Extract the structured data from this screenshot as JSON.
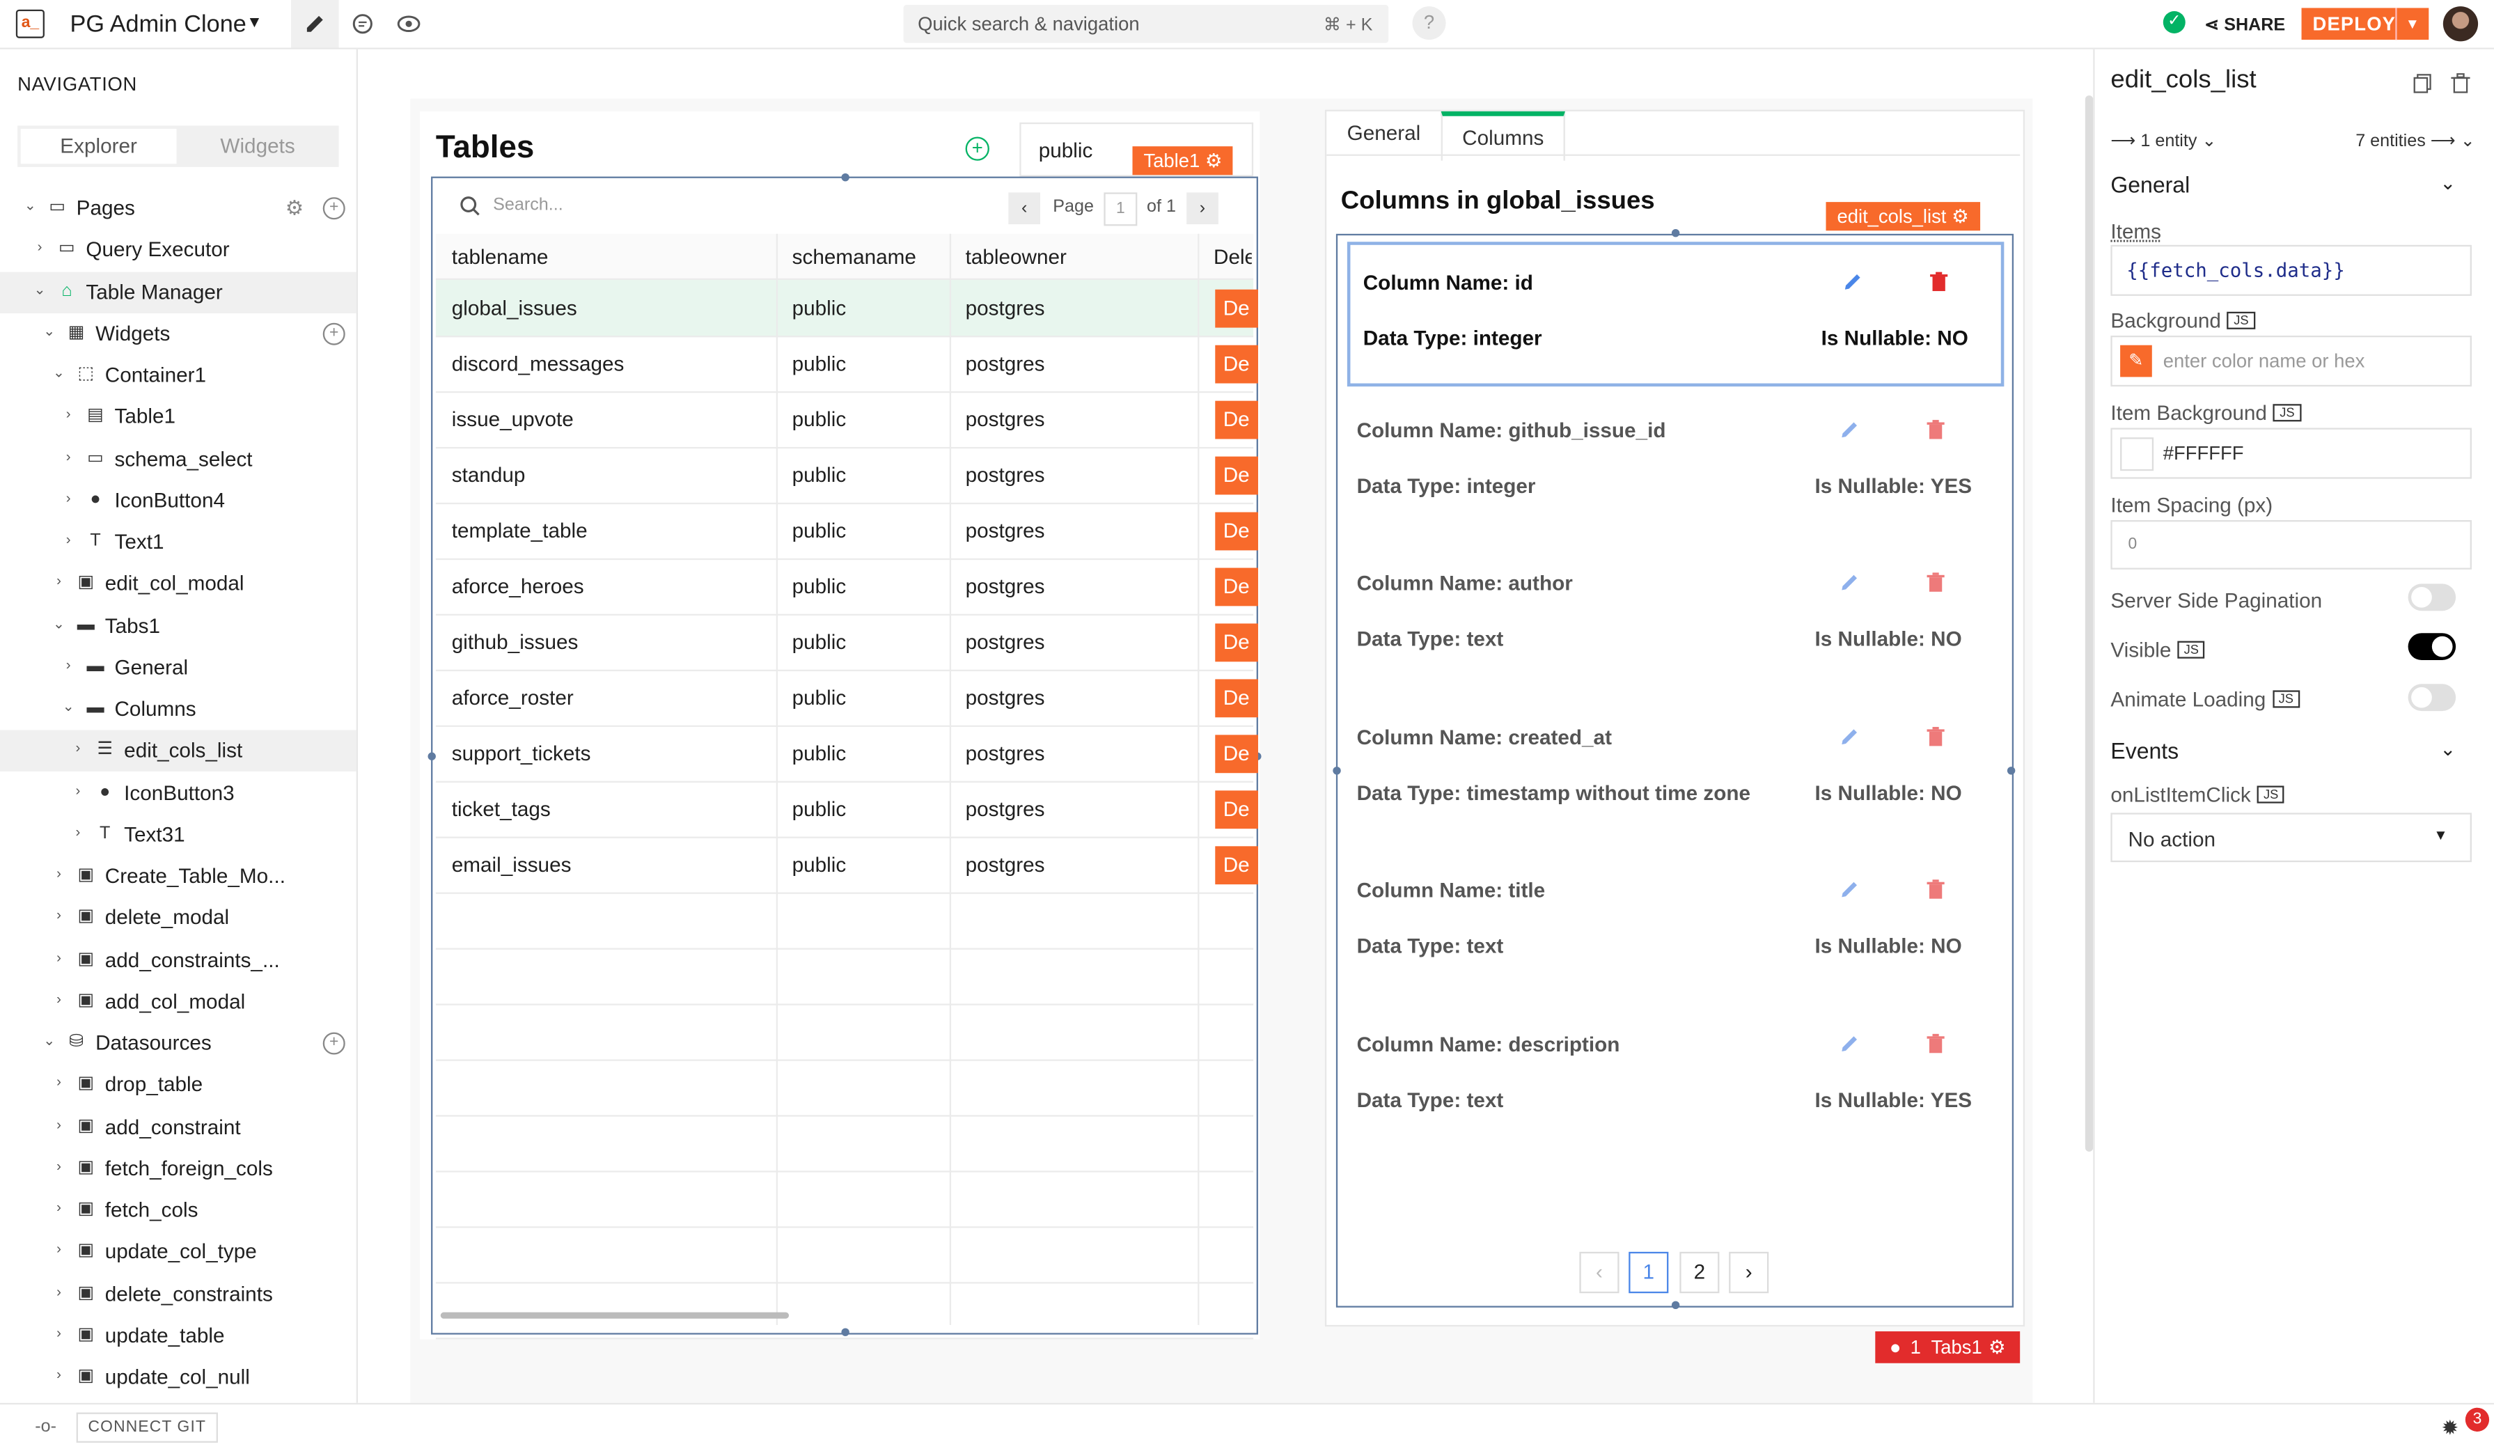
{
  "topbar": {
    "logo": "a_",
    "app_name": "PG Admin Clone",
    "search_placeholder": "Quick search & navigation",
    "search_shortcut": "⌘ + K",
    "help": "?",
    "share": "SHARE",
    "deploy": "DEPLOY"
  },
  "nav": {
    "title": "NAVIGATION",
    "tabs": [
      "Explorer",
      "Widgets"
    ],
    "items": [
      {
        "label": "Pages",
        "icon": "page",
        "indent": 0,
        "chev": "down",
        "extra": "gear-plus"
      },
      {
        "label": "Query Executor",
        "icon": "page",
        "indent": 1,
        "chev": "right"
      },
      {
        "label": "Table Manager",
        "icon": "home",
        "indent": 1,
        "chev": "down",
        "selected": true
      },
      {
        "label": "Widgets",
        "icon": "widgets",
        "indent": 2,
        "chev": "down",
        "extra": "plus"
      },
      {
        "label": "Container1",
        "icon": "container",
        "indent": 3,
        "chev": "down"
      },
      {
        "label": "Table1",
        "icon": "table",
        "indent": 4,
        "chev": "right"
      },
      {
        "label": "schema_select",
        "icon": "select",
        "indent": 4,
        "chev": "right"
      },
      {
        "label": "IconButton4",
        "icon": "iconbutton",
        "indent": 4,
        "chev": "right"
      },
      {
        "label": "Text1",
        "icon": "text",
        "indent": 4,
        "chev": "right"
      },
      {
        "label": "edit_col_modal",
        "icon": "modal",
        "indent": 3,
        "chev": "right"
      },
      {
        "label": "Tabs1",
        "icon": "tabs",
        "indent": 3,
        "chev": "down"
      },
      {
        "label": "General",
        "icon": "tabs",
        "indent": 4,
        "chev": "right"
      },
      {
        "label": "Columns",
        "icon": "tabs",
        "indent": 4,
        "chev": "down"
      },
      {
        "label": "edit_cols_list",
        "icon": "list",
        "indent": 5,
        "chev": "right",
        "selected": true
      },
      {
        "label": "IconButton3",
        "icon": "iconbutton",
        "indent": 5,
        "chev": "right"
      },
      {
        "label": "Text31",
        "icon": "text",
        "indent": 5,
        "chev": "right"
      },
      {
        "label": "Create_Table_Mo...",
        "icon": "modal",
        "indent": 3,
        "chev": "right"
      },
      {
        "label": "delete_modal",
        "icon": "modal",
        "indent": 3,
        "chev": "right"
      },
      {
        "label": "add_constraints_...",
        "icon": "modal",
        "indent": 3,
        "chev": "right"
      },
      {
        "label": "add_col_modal",
        "icon": "modal",
        "indent": 3,
        "chev": "right"
      },
      {
        "label": "Datasources",
        "icon": "db",
        "indent": 2,
        "chev": "down",
        "extra": "plus"
      },
      {
        "label": "drop_table",
        "icon": "query",
        "indent": 3,
        "chev": "right"
      },
      {
        "label": "add_constraint",
        "icon": "query",
        "indent": 3,
        "chev": "right"
      },
      {
        "label": "fetch_foreign_cols",
        "icon": "query",
        "indent": 3,
        "chev": "right"
      },
      {
        "label": "fetch_cols",
        "icon": "query",
        "indent": 3,
        "chev": "right"
      },
      {
        "label": "update_col_type",
        "icon": "query",
        "indent": 3,
        "chev": "right"
      },
      {
        "label": "delete_constraints",
        "icon": "query",
        "indent": 3,
        "chev": "right"
      },
      {
        "label": "update_table",
        "icon": "query",
        "indent": 3,
        "chev": "right"
      },
      {
        "label": "update_col_null",
        "icon": "query",
        "indent": 3,
        "chev": "right"
      }
    ]
  },
  "tables_panel": {
    "title": "Tables",
    "schema_value": "public",
    "widget_tag": "Table1",
    "search_placeholder": "Search...",
    "page_label": "Page",
    "page_value": "1",
    "page_of": "of 1",
    "columns": [
      "tablename",
      "schemaname",
      "tableowner",
      "Dele"
    ],
    "delete_label": "De",
    "rows": [
      [
        "global_issues",
        "public",
        "postgres"
      ],
      [
        "discord_messages",
        "public",
        "postgres"
      ],
      [
        "issue_upvote",
        "public",
        "postgres"
      ],
      [
        "standup",
        "public",
        "postgres"
      ],
      [
        "template_table",
        "public",
        "postgres"
      ],
      [
        "aforce_heroes",
        "public",
        "postgres"
      ],
      [
        "github_issues",
        "public",
        "postgres"
      ],
      [
        "aforce_roster",
        "public",
        "postgres"
      ],
      [
        "support_tickets",
        "public",
        "postgres"
      ],
      [
        "ticket_tags",
        "public",
        "postgres"
      ],
      [
        "email_issues",
        "public",
        "postgres"
      ]
    ]
  },
  "columns_panel": {
    "tabs": [
      "General",
      "Columns"
    ],
    "title": "Columns in global_issues",
    "widget_tag": "edit_cols_list",
    "items": [
      {
        "name": "Column Name: id",
        "type": "Data Type: integer",
        "nullable": "Is Nullable: NO"
      },
      {
        "name": "Column Name: github_issue_id",
        "type": "Data Type: integer",
        "nullable": "Is Nullable: YES"
      },
      {
        "name": "Column Name: author",
        "type": "Data Type: text",
        "nullable": "Is Nullable: NO"
      },
      {
        "name": "Column Name: created_at",
        "type": "Data Type: timestamp without time zone",
        "nullable": "Is Nullable: NO"
      },
      {
        "name": "Column Name: title",
        "type": "Data Type: text",
        "nullable": "Is Nullable: NO"
      },
      {
        "name": "Column Name: description",
        "type": "Data Type: text",
        "nullable": "Is Nullable: YES"
      }
    ],
    "pagination": {
      "prev": "‹",
      "pages": [
        "1",
        "2"
      ],
      "next": "›"
    },
    "error_tag": "1  Tabs1"
  },
  "properties": {
    "title": "edit_cols_list",
    "entity_left": "1 entity",
    "entity_right": "7 entities",
    "section_general": "General",
    "items_label": "Items",
    "items_value": "{{fetch_cols.data}}",
    "background_label": "Background",
    "background_placeholder": "enter color name or hex",
    "item_background_label": "Item Background",
    "item_background_value": "#FFFFFF",
    "item_spacing_label": "Item Spacing (px)",
    "item_spacing_value": "0",
    "server_side_label": "Server Side Pagination",
    "visible_label": "Visible",
    "animate_label": "Animate Loading",
    "events_label": "Events",
    "on_click_label": "onListItemClick",
    "on_click_value": "No action",
    "js": "JS",
    "toggles": {
      "server_side": false,
      "visible": true,
      "animate": false
    }
  },
  "bottombar": {
    "connect_git": "CONNECT GIT",
    "badge": "3"
  },
  "colors": {
    "accent": "#f86a2b",
    "success": "#03b365",
    "selection_blue": "#5f7ba1",
    "error": "#e22c2c"
  }
}
